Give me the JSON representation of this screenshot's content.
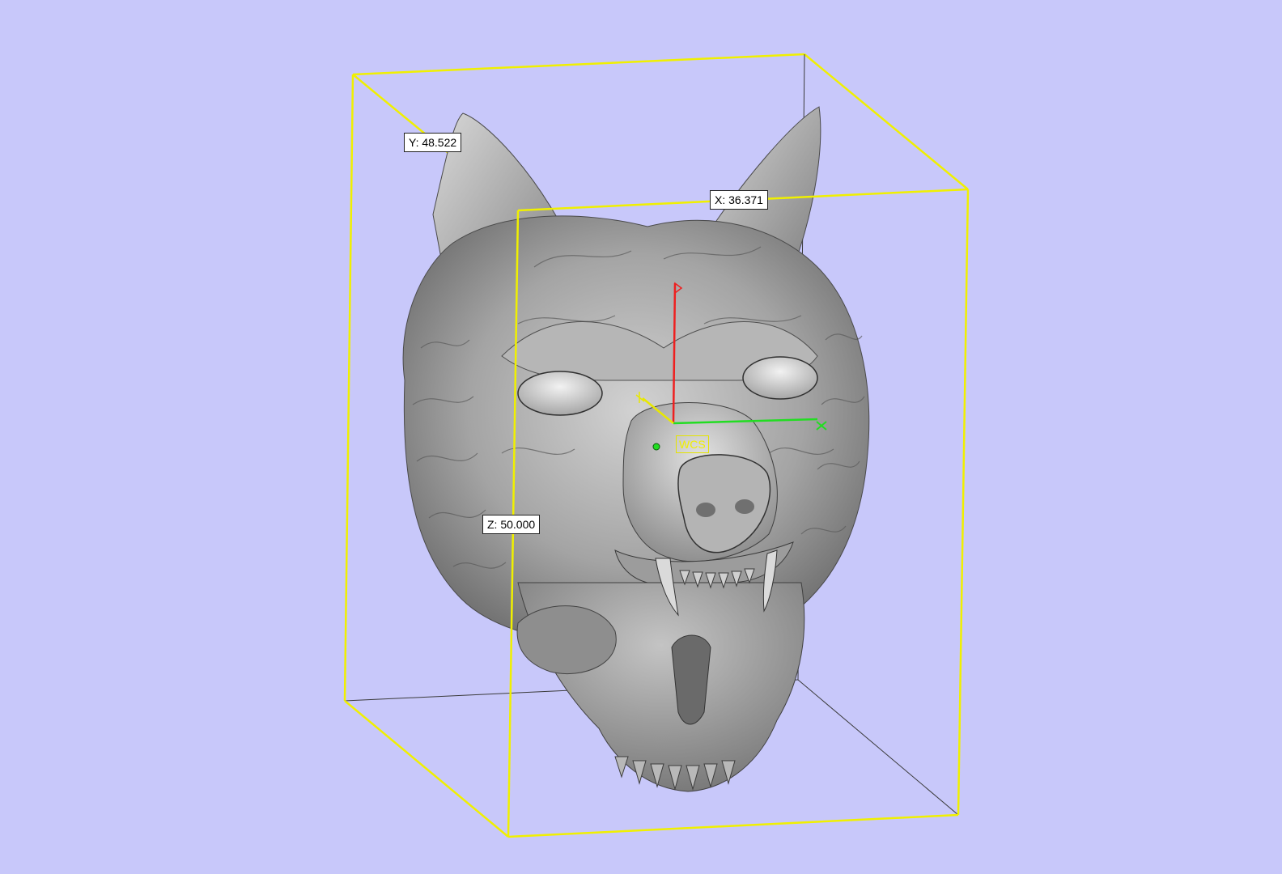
{
  "viewport": {
    "background_color": "#c8c8fa",
    "model": "wolf-head-skull-relief",
    "model_color": "#9a9a9a"
  },
  "bounding_box": {
    "color": "#f0f000",
    "dimensions": {
      "x_label": "X: 36.371",
      "y_label": "Y: 48.522",
      "z_label": "Z: 50.000"
    }
  },
  "axes": {
    "origin_label": "WCS",
    "x_color": "#22dd22",
    "y_color": "#e8e800",
    "z_color": "#ee2020",
    "x_icon": "x-axis-cross-icon",
    "origin_marker_icon": "origin-dot-icon"
  }
}
